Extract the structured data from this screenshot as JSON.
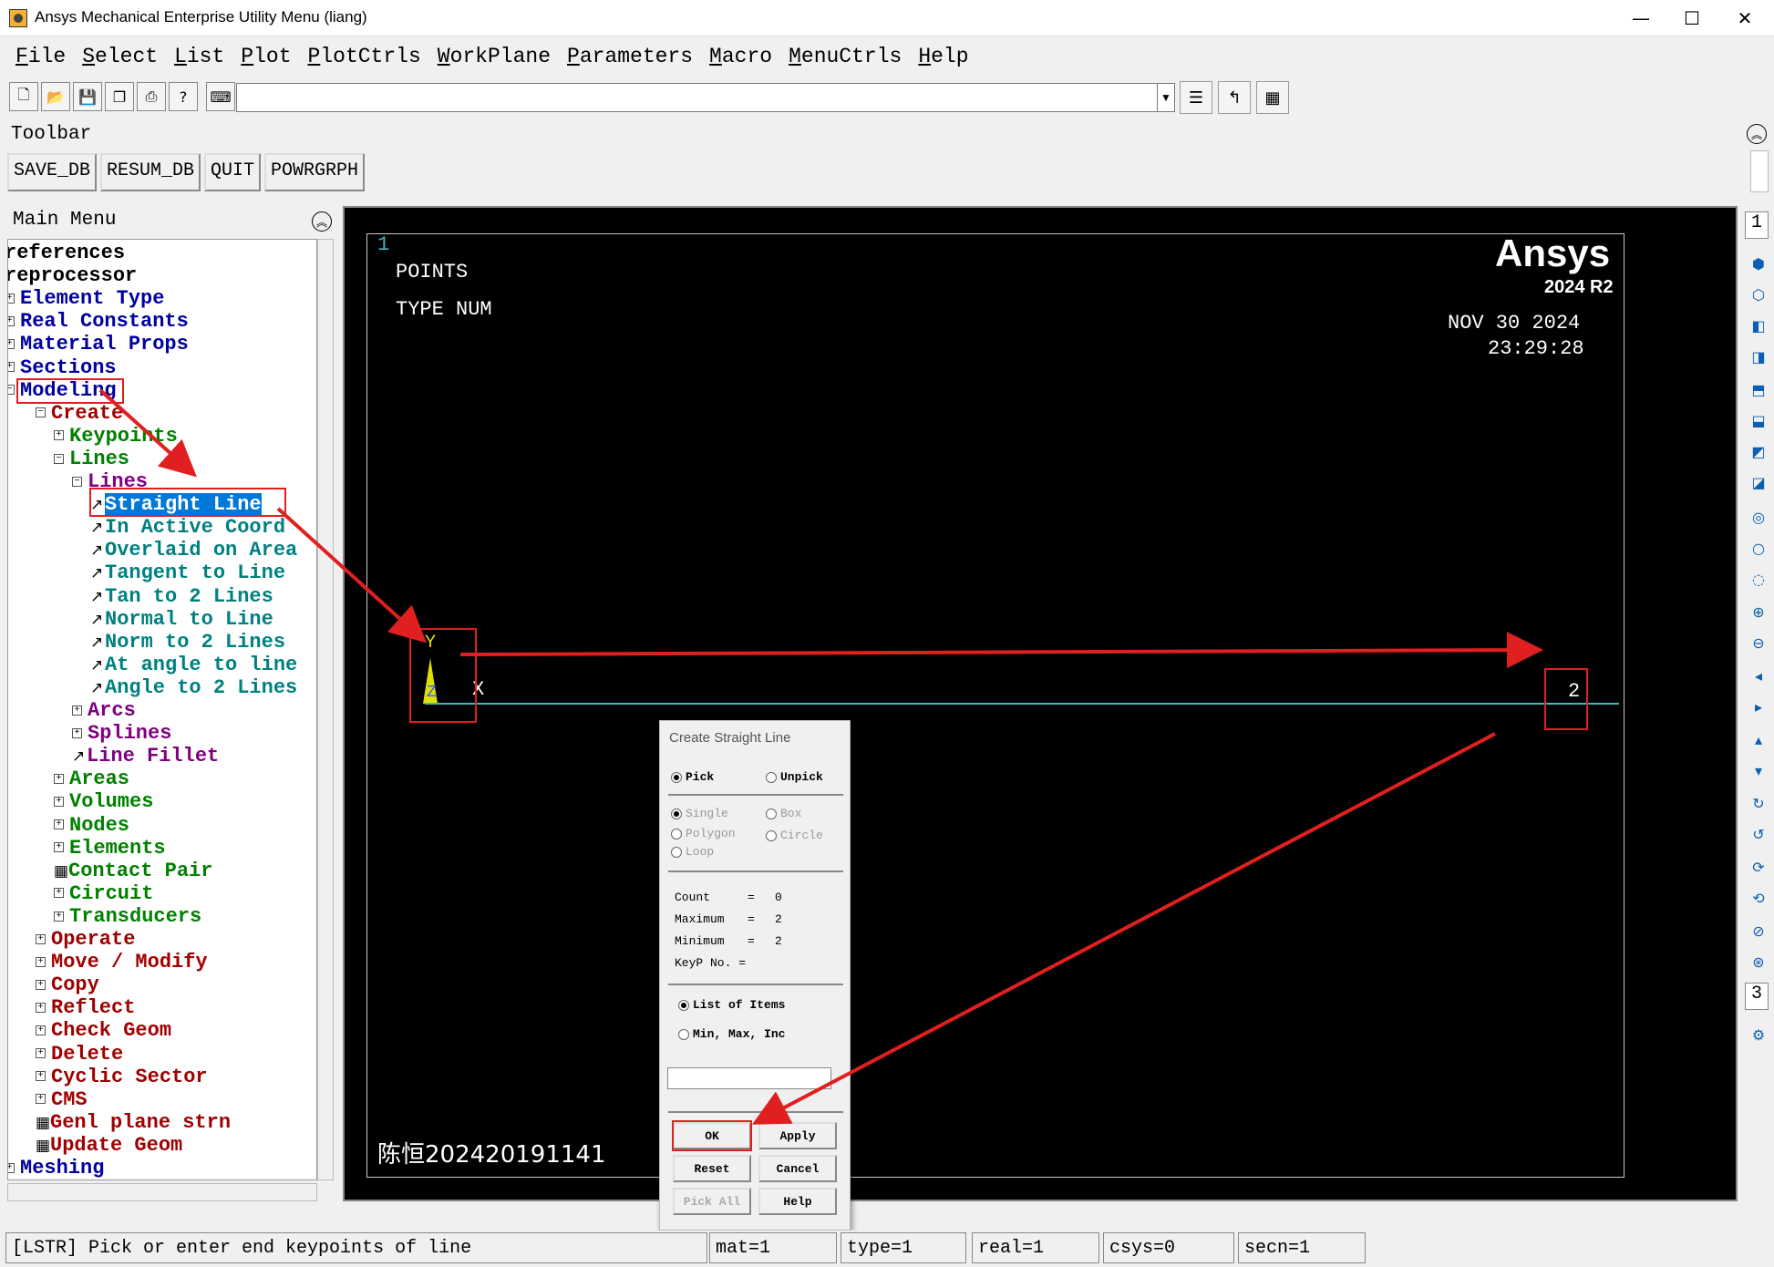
{
  "window": {
    "title": "Ansys Mechanical Enterprise Utility Menu (liang)",
    "controls": [
      "—",
      "☐",
      "✕"
    ]
  },
  "menubar": [
    "File",
    "Select",
    "List",
    "Plot",
    "PlotCtrls",
    "WorkPlane",
    "Parameters",
    "Macro",
    "MenuCtrls",
    "Help"
  ],
  "toolbar": {
    "label": "Toolbar",
    "command_value": "",
    "buttons": [
      "SAVE_DB",
      "RESUM_DB",
      "QUIT",
      "POWRGRPH"
    ]
  },
  "main_menu": {
    "label": "Main Menu",
    "items": [
      {
        "text": "references",
        "color": "blk",
        "depth": 0,
        "kind": "none"
      },
      {
        "text": "reprocessor",
        "color": "blk",
        "depth": 0,
        "kind": "none"
      },
      {
        "text": "Element Type",
        "color": "blu",
        "depth": 0,
        "kind": "plus"
      },
      {
        "text": "Real Constants",
        "color": "blu",
        "depth": 0,
        "kind": "plus"
      },
      {
        "text": "Material Props",
        "color": "blu",
        "depth": 0,
        "kind": "plus"
      },
      {
        "text": "Sections",
        "color": "blu",
        "depth": 0,
        "kind": "plus"
      },
      {
        "text": "Modeling",
        "color": "blu",
        "depth": 0,
        "kind": "minus"
      },
      {
        "text": "Create",
        "color": "red",
        "depth": 1,
        "kind": "minus"
      },
      {
        "text": "Keypoints",
        "color": "grn",
        "depth": 2,
        "kind": "plus"
      },
      {
        "text": "Lines",
        "color": "grn",
        "depth": 2,
        "kind": "minus"
      },
      {
        "text": "Lines",
        "color": "pur",
        "depth": 3,
        "kind": "minus"
      },
      {
        "text": "Straight Line",
        "color": "tea",
        "depth": 4,
        "kind": "leaf",
        "selected": true
      },
      {
        "text": "In Active Coord",
        "color": "tea",
        "depth": 4,
        "kind": "leaf"
      },
      {
        "text": "Overlaid on Area",
        "color": "tea",
        "depth": 4,
        "kind": "leaf"
      },
      {
        "text": "Tangent to Line",
        "color": "tea",
        "depth": 4,
        "kind": "leaf"
      },
      {
        "text": "Tan to 2 Lines",
        "color": "tea",
        "depth": 4,
        "kind": "leaf"
      },
      {
        "text": "Normal to Line",
        "color": "tea",
        "depth": 4,
        "kind": "leaf"
      },
      {
        "text": "Norm to 2 Lines",
        "color": "tea",
        "depth": 4,
        "kind": "leaf"
      },
      {
        "text": "At angle to line",
        "color": "tea",
        "depth": 4,
        "kind": "leaf"
      },
      {
        "text": "Angle to 2 Lines",
        "color": "tea",
        "depth": 4,
        "kind": "leaf"
      },
      {
        "text": "Arcs",
        "color": "pur",
        "depth": 3,
        "kind": "plus"
      },
      {
        "text": "Splines",
        "color": "pur",
        "depth": 3,
        "kind": "plus"
      },
      {
        "text": "Line Fillet",
        "color": "pur",
        "depth": 3,
        "kind": "leaf"
      },
      {
        "text": "Areas",
        "color": "grn",
        "depth": 2,
        "kind": "plus"
      },
      {
        "text": "Volumes",
        "color": "grn",
        "depth": 2,
        "kind": "plus"
      },
      {
        "text": "Nodes",
        "color": "grn",
        "depth": 2,
        "kind": "plus"
      },
      {
        "text": "Elements",
        "color": "grn",
        "depth": 2,
        "kind": "plus"
      },
      {
        "text": "Contact Pair",
        "color": "grn",
        "depth": 2,
        "kind": "grid"
      },
      {
        "text": "Circuit",
        "color": "grn",
        "depth": 2,
        "kind": "plus"
      },
      {
        "text": "Transducers",
        "color": "grn",
        "depth": 2,
        "kind": "plus"
      },
      {
        "text": "Operate",
        "color": "red",
        "depth": 1,
        "kind": "plus"
      },
      {
        "text": "Move / Modify",
        "color": "red",
        "depth": 1,
        "kind": "plus"
      },
      {
        "text": "Copy",
        "color": "red",
        "depth": 1,
        "kind": "plus"
      },
      {
        "text": "Reflect",
        "color": "red",
        "depth": 1,
        "kind": "plus"
      },
      {
        "text": "Check Geom",
        "color": "red",
        "depth": 1,
        "kind": "plus"
      },
      {
        "text": "Delete",
        "color": "red",
        "depth": 1,
        "kind": "plus"
      },
      {
        "text": "Cyclic Sector",
        "color": "red",
        "depth": 1,
        "kind": "plus"
      },
      {
        "text": "CMS",
        "color": "red",
        "depth": 1,
        "kind": "plus"
      },
      {
        "text": "Genl plane strn",
        "color": "red",
        "depth": 1,
        "kind": "grid"
      },
      {
        "text": "Update Geom",
        "color": "red",
        "depth": 1,
        "kind": "grid"
      },
      {
        "text": "Meshing",
        "color": "blu",
        "depth": 0,
        "kind": "plus"
      }
    ]
  },
  "graphics": {
    "window_number": "1",
    "label1": "POINTS",
    "label2": "TYPE NUM",
    "brand": "Ansys",
    "version": "2024 R2",
    "date": "NOV 30 2024",
    "time": "23:29:28",
    "axis_y": "Y",
    "axis_z": "Z",
    "axis_x": "X",
    "keypoint2": "2",
    "watermark": "陈恒202420191141"
  },
  "dialog": {
    "title": "Create Straight Line",
    "pick": "Pick",
    "unpick": "Unpick",
    "single": "Single",
    "box": "Box",
    "polygon": "Polygon",
    "circle": "Circle",
    "loop": "Loop",
    "count_label": "Count",
    "count_value": "0",
    "maximum_label": "Maximum",
    "maximum_value": "2",
    "minimum_label": "Minimum",
    "minimum_value": "2",
    "keyp_label": "KeyP No. =",
    "list_items": "List of Items",
    "min_max": "Min, Max, Inc",
    "input_value": "",
    "ok": "OK",
    "apply": "Apply",
    "reset": "Reset",
    "cancel": "Cancel",
    "pick_all": "Pick All",
    "help": "Help"
  },
  "right_strip": {
    "top_label": "1",
    "mid_label": "3"
  },
  "status": {
    "prompt": "[LSTR]  Pick or enter end keypoints of line",
    "mat": "mat=1",
    "type": "type=1",
    "real": "real=1",
    "csys": "csys=0",
    "secn": "secn=1"
  },
  "colors": {
    "annotation": "#e02020",
    "selection": "#0078d7",
    "line": "#3fb8c0"
  }
}
